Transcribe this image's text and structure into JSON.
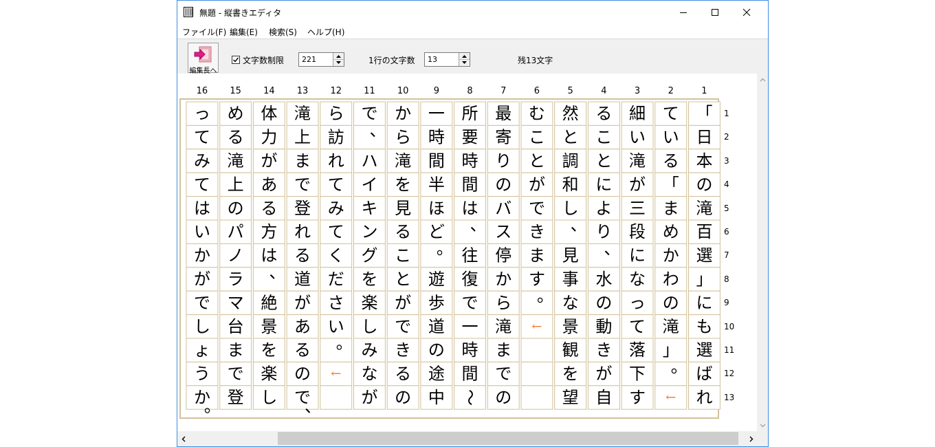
{
  "window": {
    "title": "無題 - 縦書きエディタ",
    "minimize_icon": "minimize-icon",
    "maximize_icon": "maximize-icon",
    "close_icon": "close-icon"
  },
  "menu": [
    "ファイル(F)",
    "編集(E)",
    "検索(S)",
    "ヘルプ(H)"
  ],
  "toolbar": {
    "edit_button_label": "編集長へ",
    "char_limit_label": "文字数制限",
    "char_limit_checked": true,
    "char_limit_value": "221",
    "chars_per_line_label": "1行の文字数",
    "chars_per_line_value": "13",
    "remaining_label": "残13文字"
  },
  "grid": {
    "columns": 16,
    "rows": 13,
    "column_numbers": [
      "1",
      "2",
      "3",
      "4",
      "5",
      "6",
      "7",
      "8",
      "9",
      "10",
      "11",
      "12",
      "13",
      "14",
      "15",
      "16"
    ],
    "row_numbers": [
      "1",
      "2",
      "3",
      "4",
      "5",
      "6",
      "7",
      "8",
      "9",
      "10",
      "11",
      "12",
      "13"
    ],
    "lines": [
      "「日本の滝百選」にも選ばれ",
      "ている「まめかわの滝」。←",
      "細い滝が三段になって落下す",
      "ることにより、水の動きが自",
      "然と調和し、見事な景観を望",
      "むことができます。←",
      "最寄りのバス停から滝までの",
      "所要時間は、往復で一時間～",
      "一時間半ほど。遊歩道の途中",
      "から滝を見ることができるの",
      "で、ハイキングを楽しみなが",
      "ら訪れてみてください。←",
      "滝上まで登れる道があるので、",
      "体力がある方は、絶景を楽し",
      "める滝上のパノラマ台まで登",
      "ってみてはいかがでしょうか。"
    ],
    "text_color": "#000000",
    "return_mark": "←",
    "return_mark_color": "#f07a2a",
    "grid_line_color": "#d1c19a"
  }
}
